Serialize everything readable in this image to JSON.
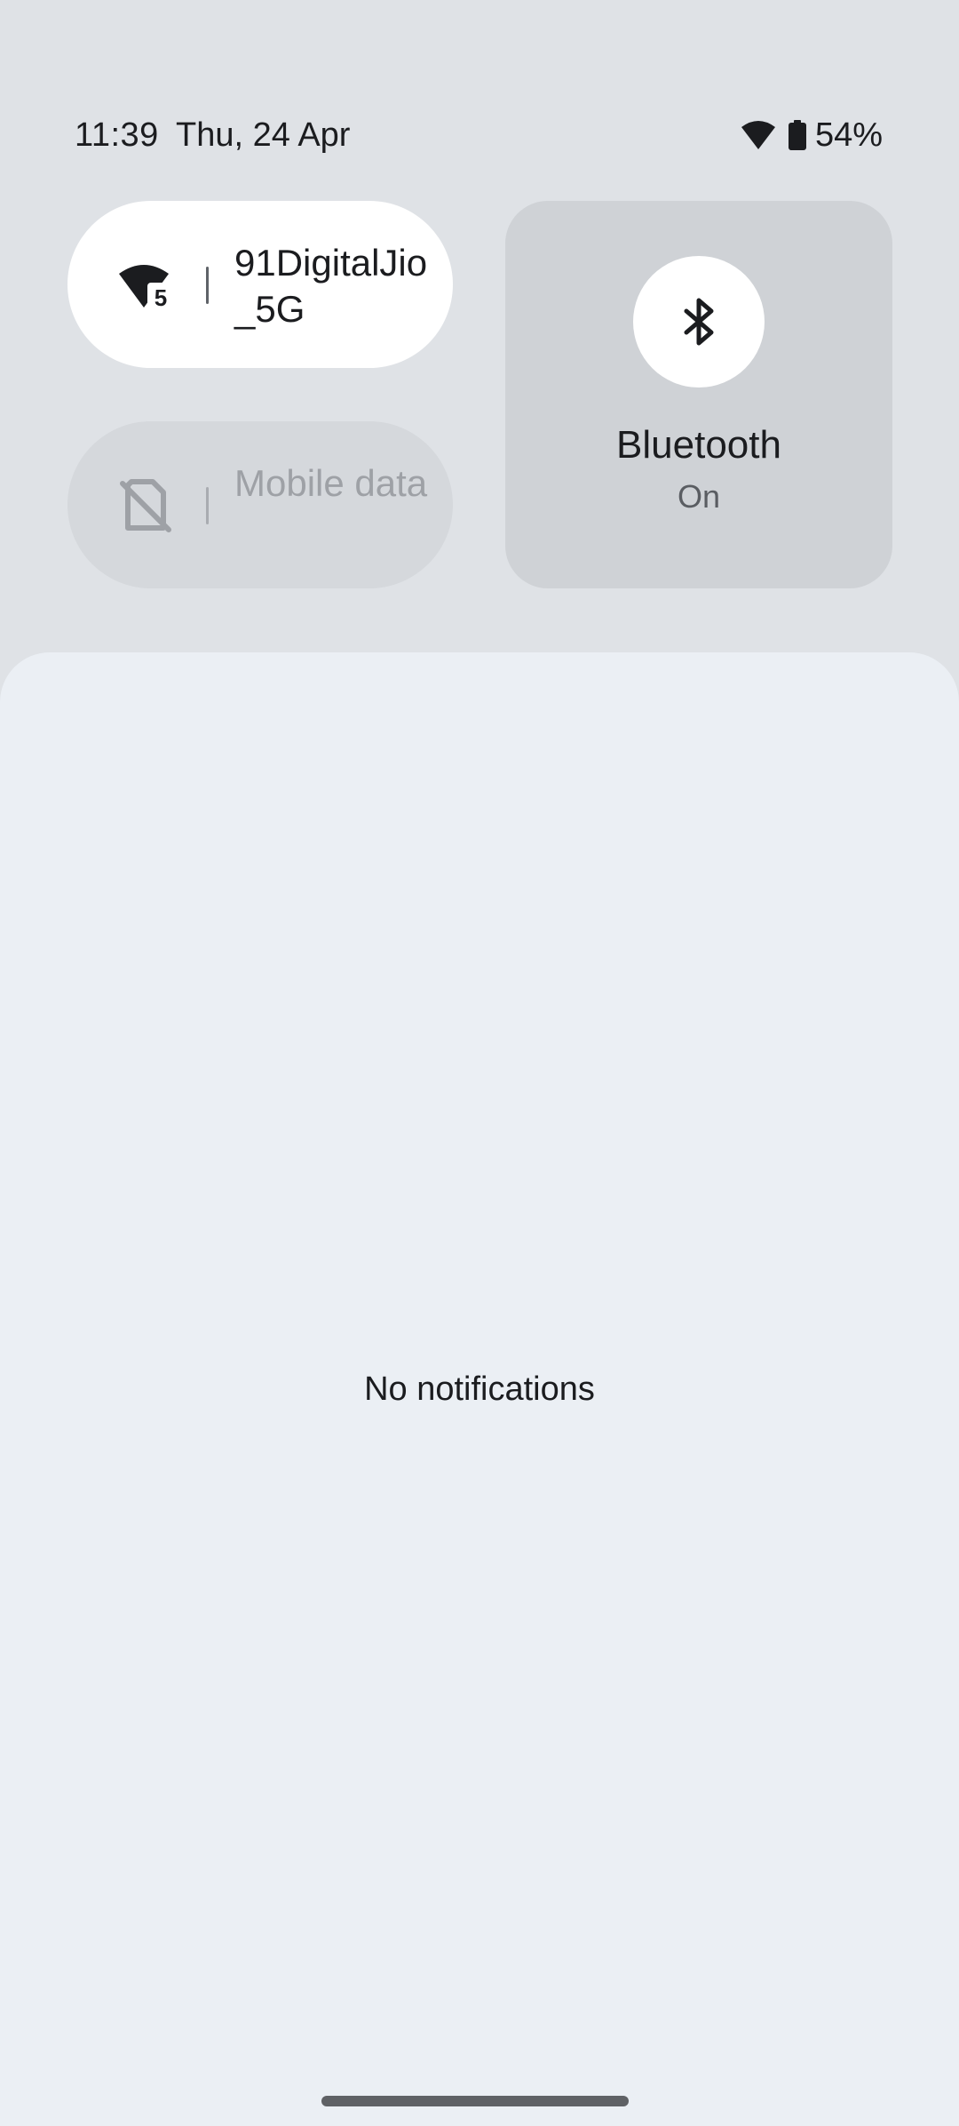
{
  "status_bar": {
    "time": "11:39",
    "date": "Thu, 24 Apr",
    "battery": "54%",
    "icons": [
      "wifi-icon",
      "battery-icon"
    ]
  },
  "tiles": {
    "wifi": {
      "label": "91DigitalJio_5G",
      "icon": "wifi-5-icon",
      "badge": "5",
      "active": true
    },
    "mobile_data": {
      "label": "Mobile data",
      "icon": "no-sim-icon",
      "active": false
    },
    "bluetooth": {
      "label": "Bluetooth",
      "state": "On",
      "icon": "bluetooth-icon",
      "active": true
    }
  },
  "notifications": {
    "empty_text": "No notifications"
  },
  "colors": {
    "background": "#dfe2e6",
    "panel": "#ebeff4",
    "tile_active": "#ffffff",
    "tile_inactive": "#d5d8dc",
    "text_primary": "#1b1c1f",
    "text_disabled": "#9ea1a6"
  }
}
